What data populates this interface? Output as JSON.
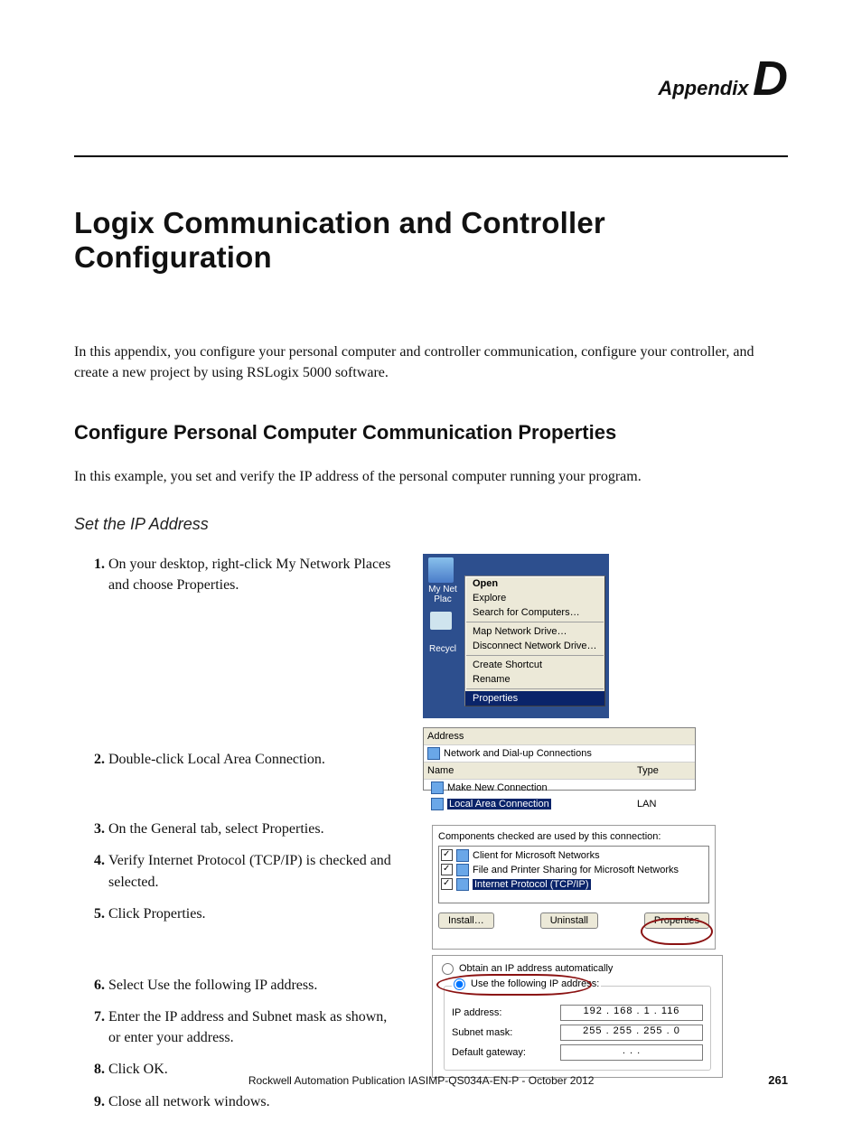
{
  "header": {
    "appendix_label": "Appendix",
    "appendix_letter": "D"
  },
  "title": "Logix Communication and Controller Configuration",
  "lead": "In this appendix, you configure your personal computer and controller communication, configure your controller, and create a new project by using RSLogix 5000 software.",
  "h2": "Configure Personal Computer Communication Properties",
  "h2_sub": "In this example, you set and verify the IP address of the personal computer running your program.",
  "h3": "Set the IP Address",
  "steps": {
    "s1": "On your desktop, right-click My Network Places and choose Properties.",
    "s2": "Double-click Local Area Connection.",
    "s3": "On the General tab, select Properties.",
    "s4": "Verify Internet Protocol (TCP/IP) is checked and selected.",
    "s5": "Click Properties.",
    "s6": "Select Use the following IP address.",
    "s7": "Enter the IP address and Subnet mask as shown, or enter your address.",
    "s8": "Click OK.",
    "s9": "Close all network windows."
  },
  "fig1": {
    "icon1_label": "My Net Plac",
    "icon2_label": "Recycl",
    "menu": {
      "open": "Open",
      "explore": "Explore",
      "search": "Search for Computers…",
      "map": "Map Network Drive…",
      "disconnect": "Disconnect Network Drive…",
      "shortcut": "Create Shortcut",
      "rename": "Rename",
      "properties": "Properties"
    }
  },
  "fig2": {
    "address_label": "Address",
    "address_value": "Network and Dial-up Connections",
    "col_name": "Name",
    "col_type": "Type",
    "row_make": "Make New Connection",
    "row_lan": "Local Area Connection",
    "row_lan_type": "LAN"
  },
  "fig3": {
    "label": "Components checked are used by this connection:",
    "c1": "Client for Microsoft Networks",
    "c2": "File and Printer Sharing for Microsoft Networks",
    "c3": "Internet Protocol (TCP/IP)",
    "btn_install": "Install…",
    "btn_uninstall": "Uninstall",
    "btn_props": "Properties"
  },
  "fig4": {
    "rad1": "Obtain an IP address automatically",
    "rad2": "Use the following IP address:",
    "ip_label": "IP address:",
    "ip_value": "192 . 168 .  1  . 116",
    "mask_label": "Subnet mask:",
    "mask_value": "255 . 255 . 255 .  0",
    "gw_label": "Default gateway:",
    "gw_value": " .       .       ."
  },
  "footer": {
    "pub": "Rockwell Automation Publication IASIMP-QS034A-EN-P - ",
    "date": "October 2012",
    "page": "261"
  }
}
